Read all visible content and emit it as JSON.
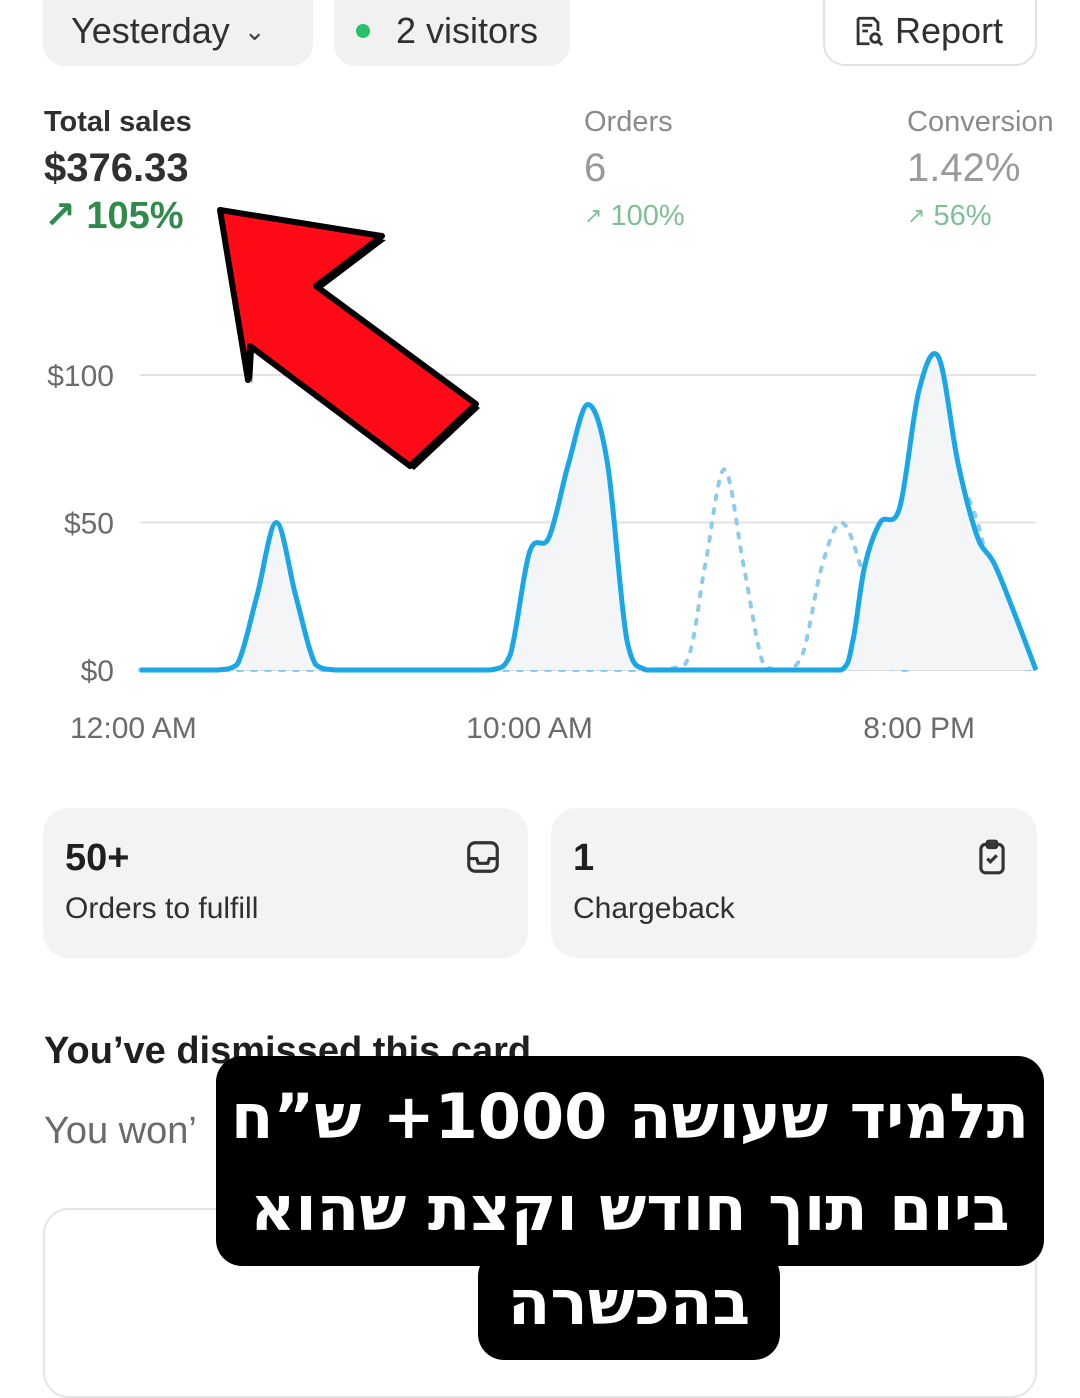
{
  "header": {
    "date_range": "Yesterday",
    "visitors": "2 visitors",
    "report_label": "Report"
  },
  "metrics": [
    {
      "label": "Total sales",
      "value": "$376.33",
      "change": "105%"
    },
    {
      "label": "Orders",
      "value": "6",
      "change": "100%"
    },
    {
      "label": "Conversion",
      "value": "1.42%",
      "change": "56%"
    }
  ],
  "chart_data": {
    "type": "line",
    "title": "",
    "x_ticks": [
      "12:00 AM",
      "10:00 AM",
      "8:00 PM"
    ],
    "y_ticks": [
      "$100",
      "$50",
      "$0"
    ],
    "ylim": [
      0,
      100
    ],
    "grid": true,
    "colors": {
      "current": "#1ba6e6",
      "previous": "#8ccbe9"
    },
    "series": [
      {
        "style": "solid",
        "x": [
          0,
          1,
          1.5,
          2,
          2.5,
          3,
          3.5,
          4,
          4.5,
          5,
          5.5,
          6,
          6.5,
          7,
          8,
          9,
          9.5,
          10,
          10.5,
          11,
          11.5,
          12,
          12.5,
          13,
          14,
          15,
          16,
          17,
          18,
          18.3,
          18.6,
          19,
          19.5,
          20,
          20.5,
          21,
          21.5,
          22,
          23
        ],
        "y": [
          0,
          0,
          0,
          0,
          2,
          25,
          50,
          25,
          2,
          0,
          0,
          0,
          0,
          0,
          0,
          0,
          5,
          40,
          45,
          70,
          90,
          70,
          10,
          0,
          0,
          0,
          0,
          0,
          0,
          10,
          35,
          50,
          55,
          95,
          106,
          70,
          45,
          34,
          0
        ]
      },
      {
        "style": "dotted",
        "x": [
          0,
          1,
          2,
          3,
          4,
          5,
          6,
          7,
          8,
          9,
          10,
          11,
          12,
          13,
          14,
          14.5,
          15,
          15.5,
          16,
          16.5,
          17,
          17.5,
          18,
          18.5,
          19,
          19.5,
          20,
          20.5,
          21,
          21.5,
          22,
          22.5,
          23
        ],
        "y": [
          0,
          0,
          0,
          0,
          0,
          0,
          0,
          0,
          0,
          0,
          0,
          0,
          0,
          0,
          2,
          35,
          68,
          35,
          2,
          0,
          5,
          35,
          50,
          35,
          5,
          0,
          2,
          30,
          60,
          50,
          20,
          2,
          0
        ]
      }
    ]
  },
  "cards": [
    {
      "value": "50+",
      "label": "Orders to fulfill",
      "icon": "inbox-icon"
    },
    {
      "value": "1",
      "label": "Chargeback",
      "icon": "clipboard-check-icon"
    }
  ],
  "dismissed": {
    "title": "You’ve dismissed this card",
    "text": "You won’"
  },
  "overlay": {
    "arrow_color": "#ff0a16",
    "caption_lines": [
      "תלמיד שעושה 1000+ ש”ח",
      "ביום תוך חודש וקצת שהוא",
      "בהכשרה"
    ]
  }
}
